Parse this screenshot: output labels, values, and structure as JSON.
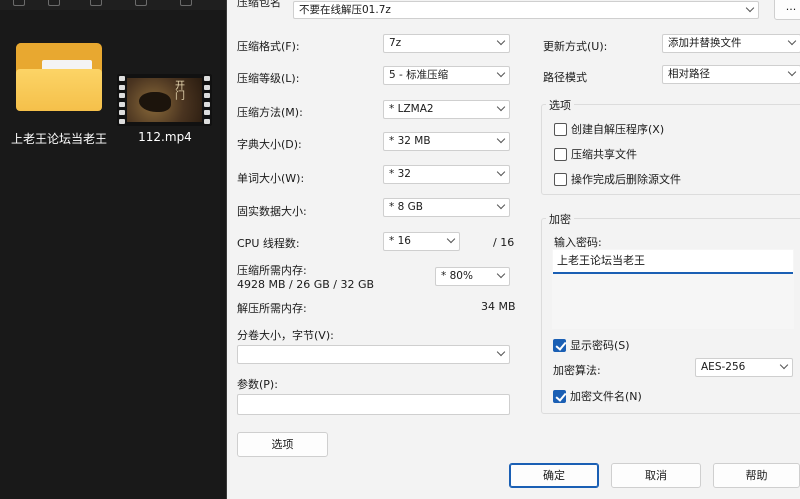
{
  "desktop": {
    "folder_name": "上老王论坛当老王",
    "video_name": "112.mp4",
    "video_overlay_text": "开门"
  },
  "archive": {
    "name_label": "压缩包名",
    "name_value": "不要在线解压01.7z",
    "browse_label": "..."
  },
  "left": {
    "format_label": "压缩格式(F):",
    "format_value": "7z",
    "level_label": "压缩等级(L):",
    "level_value": "5 - 标准压缩",
    "method_label": "压缩方法(M):",
    "method_value": "* LZMA2",
    "dict_label": "字典大小(D):",
    "dict_value": "* 32 MB",
    "word_label": "单词大小(W):",
    "word_value": "* 32",
    "solid_label": "固实数据大小:",
    "solid_value": "* 8 GB",
    "cpu_label": "CPU 线程数:",
    "cpu_value": "* 16",
    "cpu_total": "/ 16",
    "mem_label": "压缩所需内存:",
    "mem_value": "4928 MB / 26 GB / 32 GB",
    "mem_percent": "* 80%",
    "decomp_label": "解压所需内存:",
    "decomp_value": "34 MB",
    "split_label": "分卷大小，字节(V):",
    "split_value": "",
    "params_label": "参数(P):",
    "params_value": "",
    "options_button": "选项"
  },
  "right": {
    "update_label": "更新方式(U):",
    "update_value": "添加并替换文件",
    "path_label": "路径模式",
    "path_value": "相对路径",
    "options_group": "选项",
    "opt_sfx": "创建自解压程序(X)",
    "opt_shared": "压缩共享文件",
    "opt_delete": "操作完成后删除源文件",
    "enc_group": "加密",
    "pw_label": "输入密码:",
    "pw_value": "上老王论坛当老王",
    "show_pw": "显示密码(S)",
    "algo_label": "加密算法:",
    "algo_value": "AES-256",
    "enc_names": "加密文件名(N)"
  },
  "buttons": {
    "ok": "确定",
    "cancel": "取消",
    "help": "帮助"
  }
}
